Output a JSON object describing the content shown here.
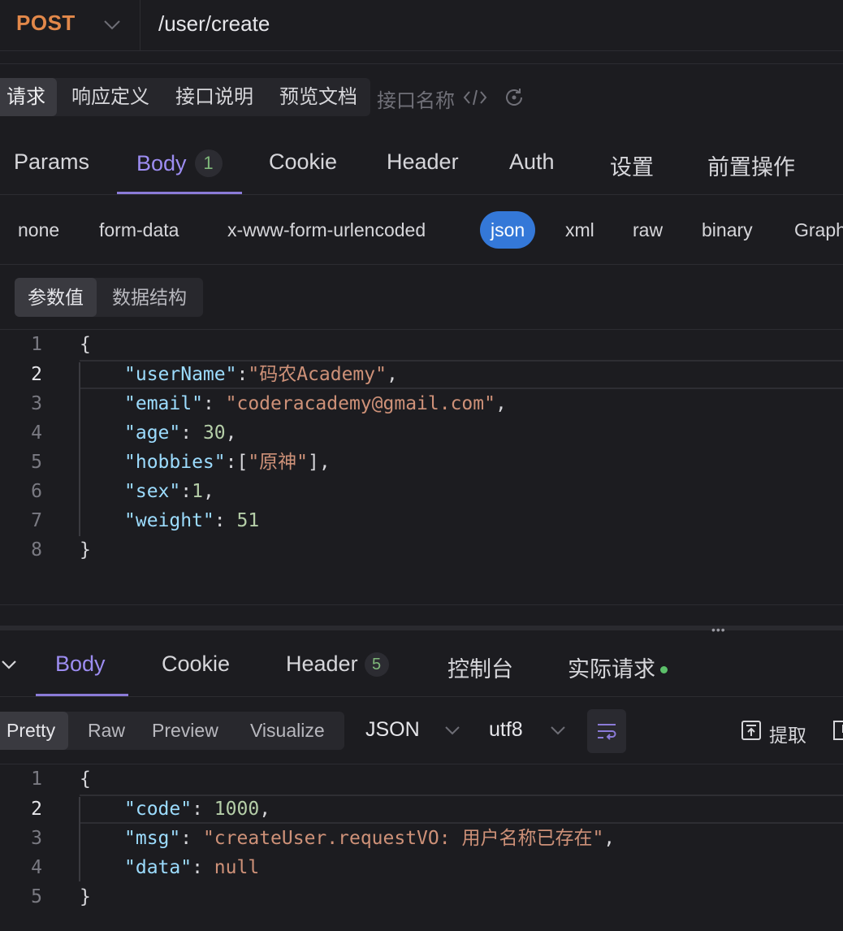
{
  "request": {
    "method": "POST",
    "url": "/user/create"
  },
  "req_tabs": [
    "请求",
    "响应定义",
    "接口说明",
    "预览文档"
  ],
  "iface_name_placeholder": "接口名称",
  "main_tabs": {
    "params": "Params",
    "body": "Body",
    "body_badge": "1",
    "cookie": "Cookie",
    "header": "Header",
    "auth": "Auth",
    "settings": "设置",
    "pre": "前置操作"
  },
  "body_types": [
    "none",
    "form-data",
    "x-www-form-urlencoded",
    "json",
    "xml",
    "raw",
    "binary",
    "Graph"
  ],
  "body_selected": "json",
  "body_seg": [
    "参数值",
    "数据结构"
  ],
  "request_body": {
    "line_numbers": [
      "1",
      "2",
      "3",
      "4",
      "5",
      "6",
      "7",
      "8"
    ],
    "open": "{",
    "close": "}",
    "fields": [
      {
        "key": "\"userName\"",
        "sep": ":",
        "val": "\"码农Academy\"",
        "tail": ","
      },
      {
        "key": "\"email\"",
        "sep": ": ",
        "val": "\"coderacademy@gmail.com\"",
        "tail": ","
      },
      {
        "key": "\"age\"",
        "sep": ": ",
        "val": "30",
        "tail": ","
      },
      {
        "key": "\"hobbies\"",
        "sep": ":[",
        "val": "\"原神\"",
        "tail": "],"
      },
      {
        "key": "\"sex\"",
        "sep": ":",
        "val": "1",
        "tail": ","
      },
      {
        "key": "\"weight\"",
        "sep": ": ",
        "val": "51",
        "tail": ""
      }
    ]
  },
  "response_tabs": {
    "body": "Body",
    "cookie": "Cookie",
    "header": "Header",
    "header_badge": "5",
    "console": "控制台",
    "actual": "实际请求"
  },
  "response_view": [
    "Pretty",
    "Raw",
    "Preview",
    "Visualize"
  ],
  "format": "JSON",
  "encoding": "utf8",
  "extract_label": "提取",
  "response_body": {
    "line_numbers": [
      "1",
      "2",
      "3",
      "4",
      "5"
    ],
    "open": "{",
    "close": "}",
    "fields": [
      {
        "key": "\"code\"",
        "sep": ": ",
        "val": "1000",
        "tail": ","
      },
      {
        "key": "\"msg\"",
        "sep": ": ",
        "val": "\"createUser.requestVO: 用户名称已存在\"",
        "tail": ","
      },
      {
        "key": "\"data\"",
        "sep": ": ",
        "val": "null",
        "tail": ""
      }
    ]
  },
  "colors": {
    "method": "#e2884a",
    "accent": "#9d8df2",
    "selected_pill": "#3478d8",
    "badge_text": "#7fb87a"
  }
}
